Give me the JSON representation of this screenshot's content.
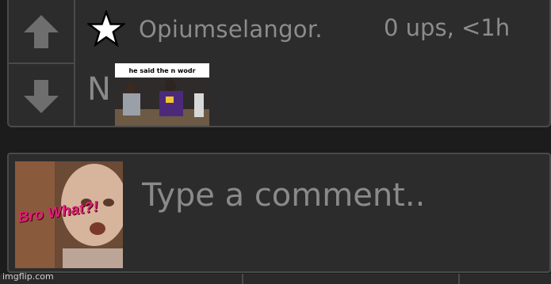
{
  "comment": {
    "username": "Opiumselangor.",
    "meta": "0 ups, <1h",
    "body_text": "N",
    "meme_caption": "he said the n wodr",
    "upvote_icon": "arrow-up-icon",
    "downvote_icon": "arrow-down-icon",
    "favorite_icon": "star-icon"
  },
  "reply_box": {
    "placeholder": "Type a comment..",
    "avatar_text": "Bro What?!"
  },
  "footer": {
    "watermark": "imgflip.com"
  },
  "colors": {
    "background": "#1c1c1c",
    "card": "#2c2c2c",
    "border": "#4a4a4a",
    "text_muted": "#8c8c8c",
    "avatar_text": "#e0207a"
  }
}
